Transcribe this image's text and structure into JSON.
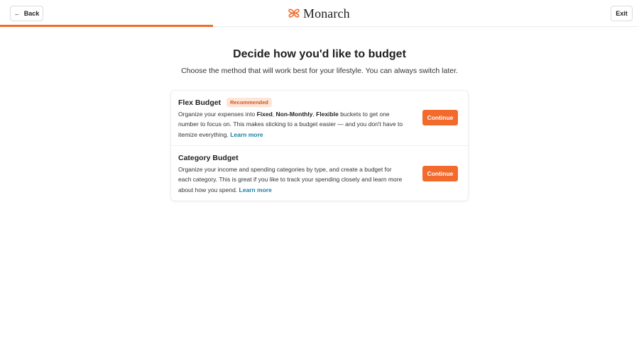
{
  "header": {
    "back_label": "Back",
    "back_icon": "arrow-left-icon",
    "exit_label": "Exit",
    "logo_text": "Monarch",
    "progress_fraction": 0.333,
    "accent_color": "#f26b2c"
  },
  "page": {
    "title": "Decide how you'd like to budget",
    "subtitle": "Choose the method that will work best for your lifestyle. You can always switch later."
  },
  "options": [
    {
      "title": "Flex Budget",
      "badge": "Recommended",
      "desc_1": "Organize your expenses into ",
      "desc_bold_1": "Fixed",
      "desc_sep_1": ", ",
      "desc_bold_2": "Non-Monthly",
      "desc_sep_2": ", ",
      "desc_bold_3": "Flexible",
      "desc_2": " buckets to get one number to focus on. This makes sticking to a budget easier — and you don't have to itemize everything. ",
      "link": "Learn more",
      "button": "Continue"
    },
    {
      "title": "Category Budget",
      "desc": "Organize your income and spending categories by type, and create a budget for each category. This is great if you like to track your spending closely and learn more about how you spend. ",
      "link": "Learn more",
      "button": "Continue"
    }
  ]
}
